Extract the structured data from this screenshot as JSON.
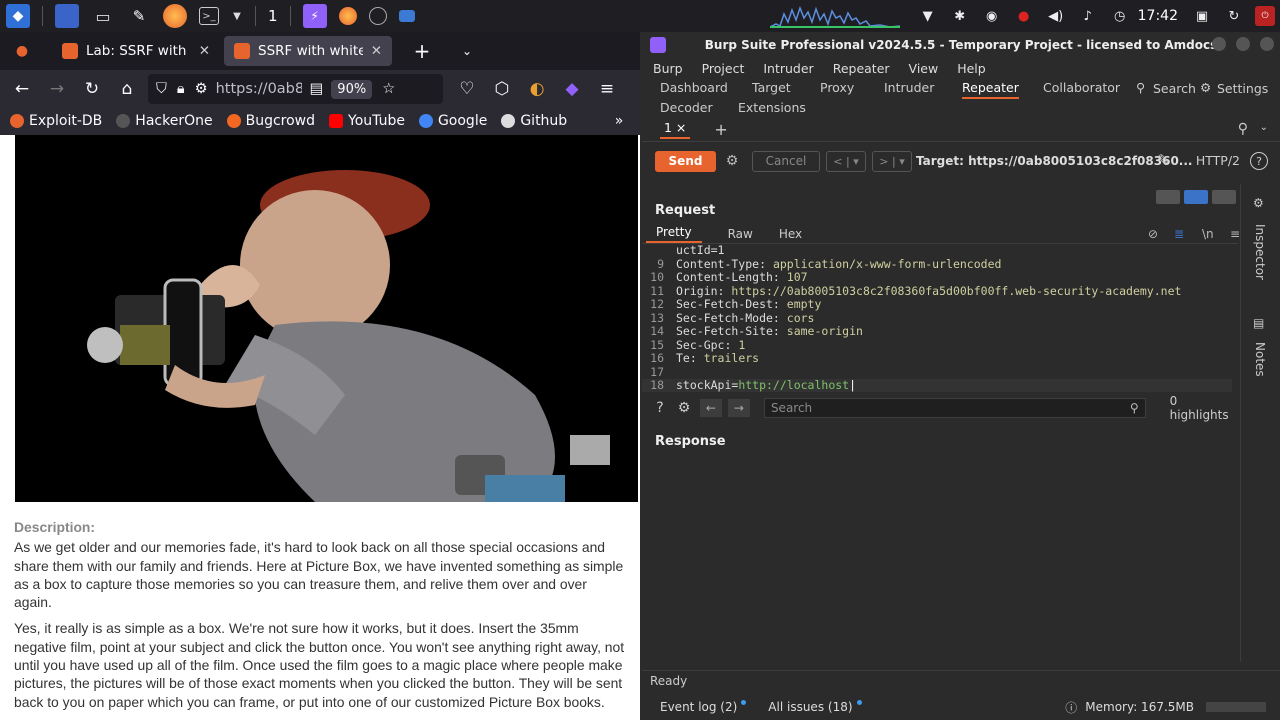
{
  "taskbar": {
    "workspace": "1",
    "clock": "17:42"
  },
  "firefox": {
    "tabs": [
      {
        "label": "Lab: SSRF with wh"
      },
      {
        "label": "SSRF with whitelis"
      }
    ],
    "url": "https://0ab8",
    "zoom": "90%",
    "bookmarks": [
      {
        "label": "Exploit-DB",
        "color": "#e8642e"
      },
      {
        "label": "HackerOne",
        "color": "#555555"
      },
      {
        "label": "Bugcrowd",
        "color": "#f26822"
      },
      {
        "label": "YouTube",
        "color": "#ff0000"
      },
      {
        "label": "Google",
        "color": "#4285f4"
      },
      {
        "label": "Github",
        "color": "#dddddd"
      }
    ]
  },
  "page": {
    "description_heading": "Description:",
    "paragraphs": [
      "As we get older and our memories fade, it's hard to look back on all those special occasions and share them with our family and friends. Here at Picture Box, we have invented something as simple as a box to capture those memories so you can treasure them, and relive them over and over again.",
      "Yes, it really is as simple as a box. We're not sure how it works, but it does. Insert the 35mm negative film, point at your subject and click the button once. You won't see anything right away, not until you have used up all of the film. Once used the film goes to a magic place where people make pictures, the pictures will be of those exact moments when you clicked the button. They will be sent back to you on paper which you can frame, or put into one of our customized Picture Box books."
    ]
  },
  "burp": {
    "title": "Burp Suite Professional v2024.5.5 - Temporary Project - licensed to Amdocs",
    "menu": [
      "Burp",
      "Project",
      "Intruder",
      "Repeater",
      "View",
      "Help"
    ],
    "tools": [
      "Dashboard",
      "Target",
      "Proxy",
      "Intruder",
      "Repeater",
      "Collaborator",
      "Search",
      "Settings",
      "Decoder",
      "Extensions"
    ],
    "repeater_tab": "1 ×",
    "send": "Send",
    "cancel": "Cancel",
    "target": "Target: https://0ab8005103c8c2f08360...",
    "protocol": "HTTP/2",
    "request_heading": "Request",
    "request_tabs": [
      "Pretty",
      "Raw",
      "Hex"
    ],
    "request_lines": [
      {
        "n": "",
        "k": "uctId=1",
        "v": ""
      },
      {
        "n": "9",
        "k": "Content-Type:",
        "v": " application/x-www-form-urlencoded"
      },
      {
        "n": "10",
        "k": "Content-Length:",
        "v": " 107"
      },
      {
        "n": "11",
        "k": "Origin:",
        "v": " https://0ab8005103c8c2f08360fa5d00bf00ff.web-security-academy.net"
      },
      {
        "n": "12",
        "k": "Sec-Fetch-Dest:",
        "v": " empty"
      },
      {
        "n": "13",
        "k": "Sec-Fetch-Mode:",
        "v": " cors"
      },
      {
        "n": "14",
        "k": "Sec-Fetch-Site:",
        "v": " same-origin"
      },
      {
        "n": "15",
        "k": "Sec-Gpc:",
        "v": " 1"
      },
      {
        "n": "16",
        "k": "Te:",
        "v": " trailers"
      },
      {
        "n": "17",
        "k": "",
        "v": ""
      }
    ],
    "body_line": {
      "n": "18",
      "param": "stockApi=",
      "value": "http://localhost"
    },
    "search_placeholder": "Search",
    "highlights": "0 highlights",
    "response_heading": "Response",
    "side_labels": [
      "Inspector",
      "Notes"
    ],
    "status": "Ready",
    "footer": {
      "event_log": "Event log (2)",
      "issues": "All issues (18)",
      "memory": "Memory: 167.5MB"
    }
  }
}
